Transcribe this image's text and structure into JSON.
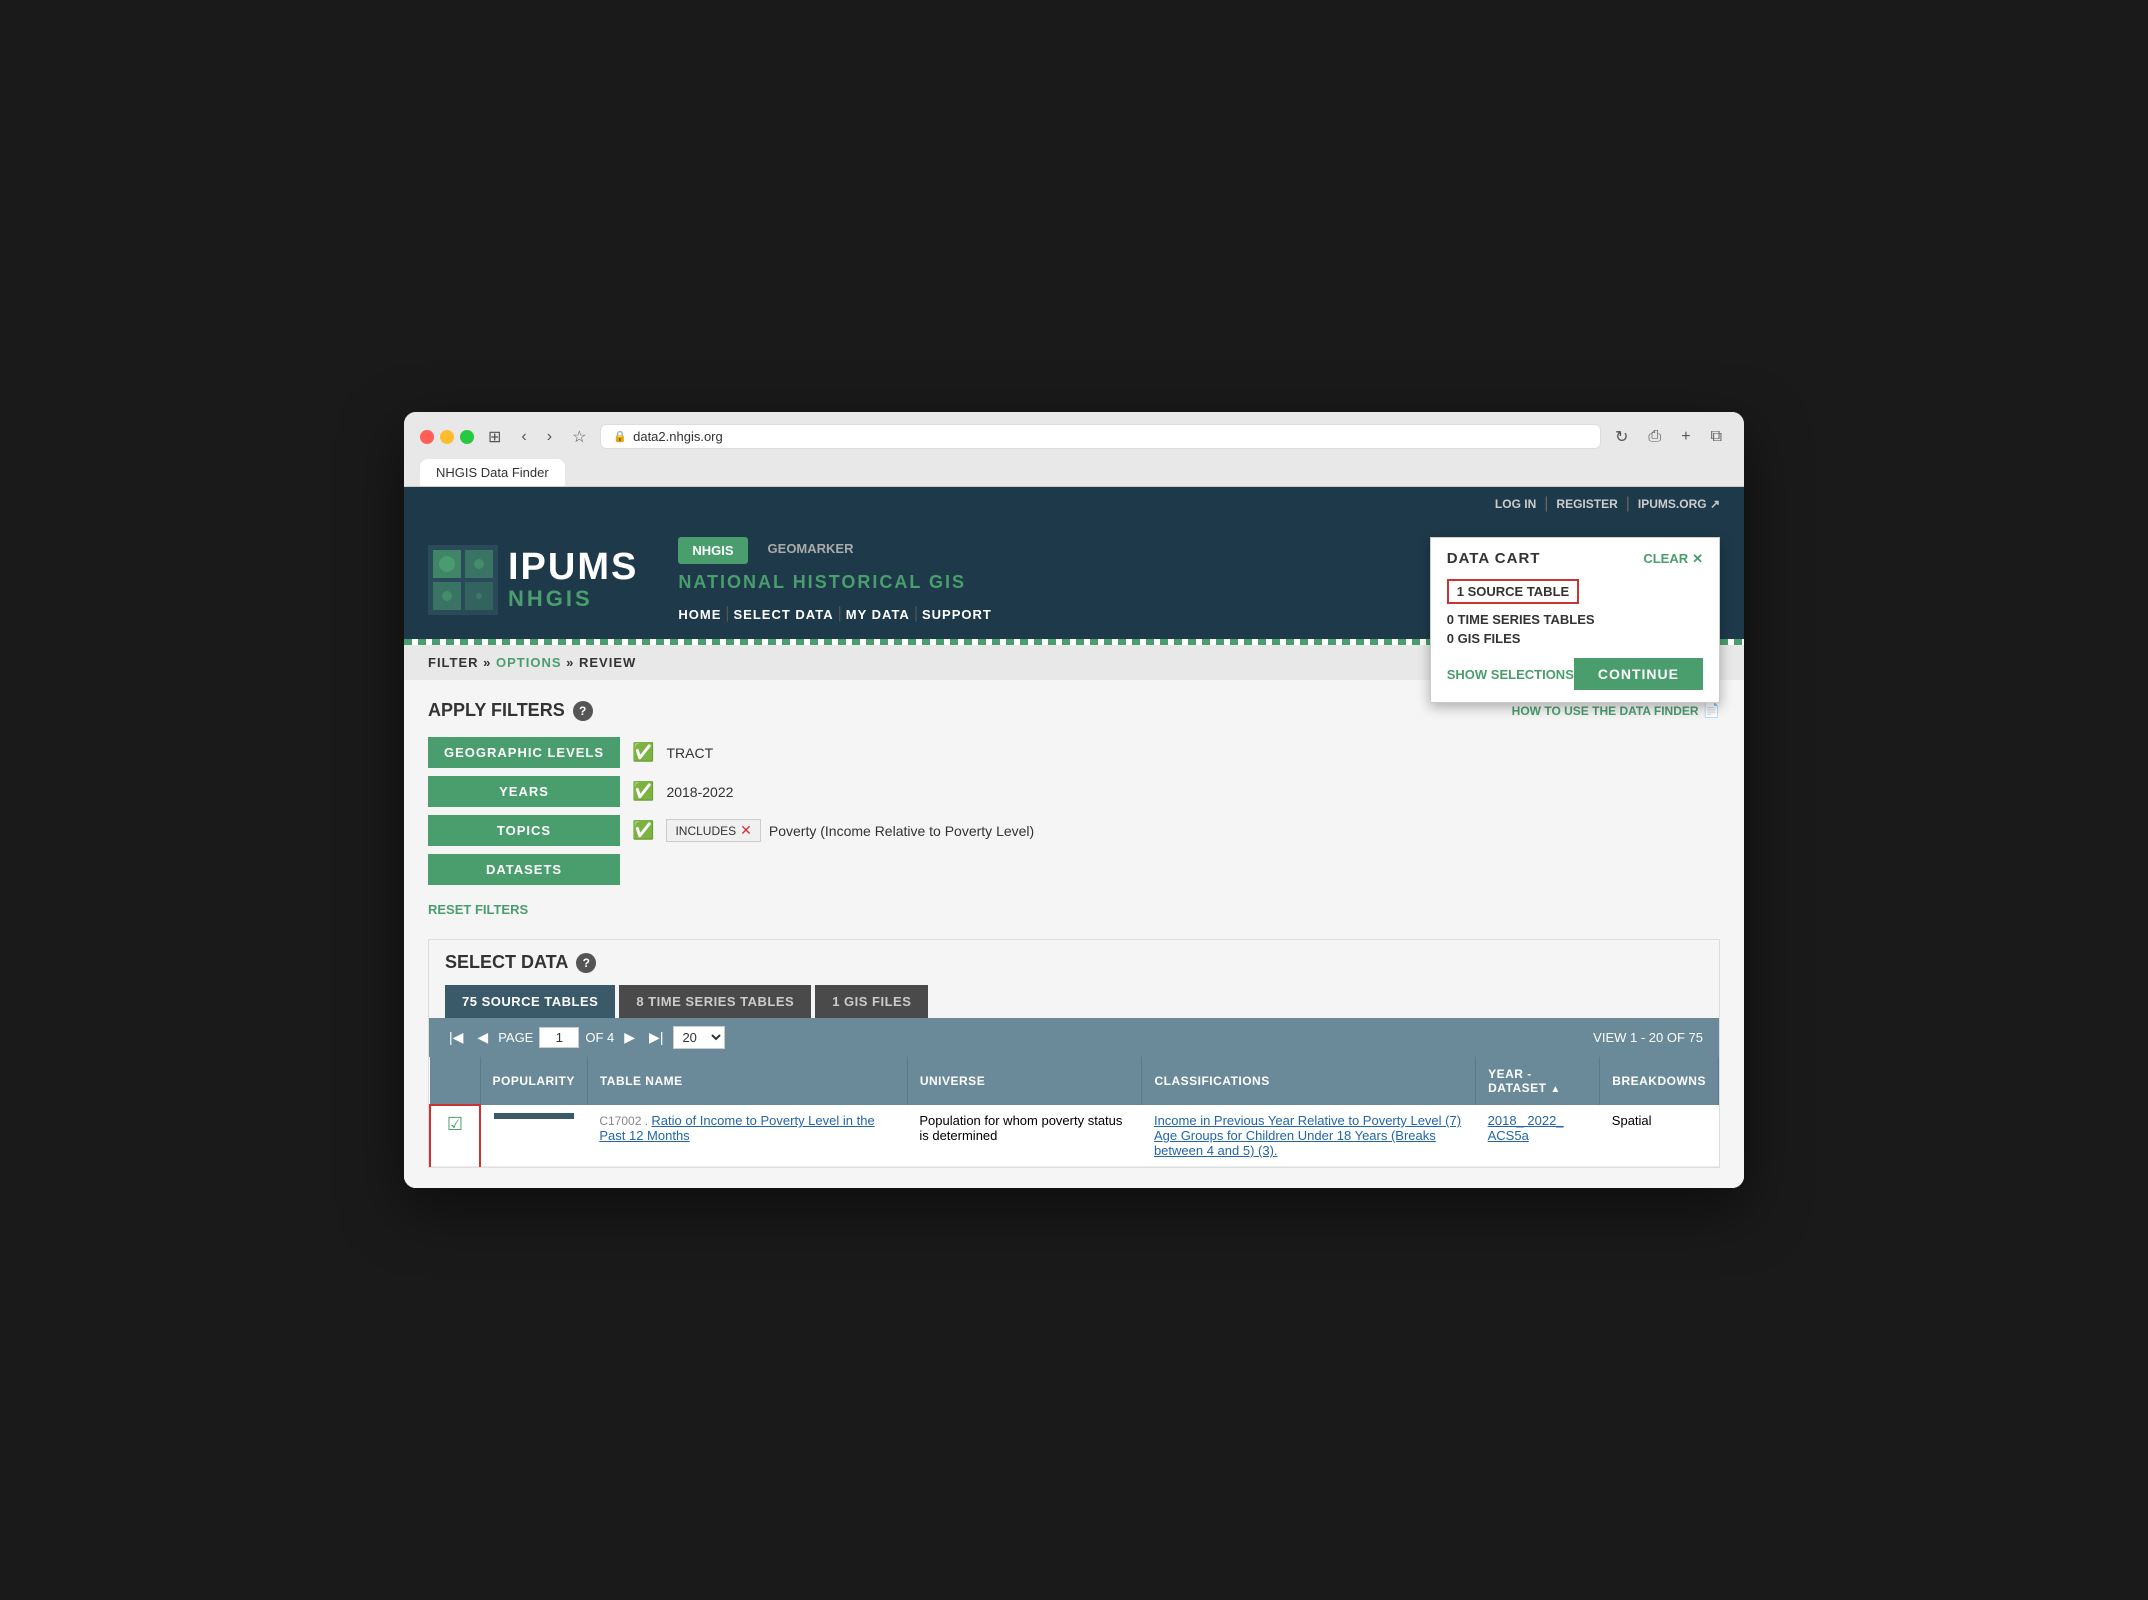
{
  "browser": {
    "url": "data2.nhgis.org",
    "tab_title": "NHGIS Data Finder"
  },
  "topnav": {
    "login": "LOG IN",
    "register": "REGISTER",
    "ipums": "IPUMS.ORG"
  },
  "header": {
    "logo_name": "IPUMS",
    "logo_sub": "NHGIS",
    "product_nhgis": "NHGIS",
    "product_geomarker": "GEOMARKER",
    "product_title": "NATIONAL HISTORICAL GIS",
    "nav_home": "HOME",
    "nav_select": "SELECT DATA",
    "nav_mydata": "MY DATA",
    "nav_support": "SUPPORT"
  },
  "cart": {
    "title": "DATA CART",
    "clear": "CLEAR",
    "source_tables": "1  SOURCE TABLE",
    "time_series": "0 TIME SERIES TABLES",
    "gis_files": "0 GIS FILES",
    "show_selections": "SHOW SELECTIONS",
    "continue": "CONTINUE"
  },
  "breadcrumb": {
    "filter": "FILTER",
    "options": "OPTIONS",
    "review": "REVIEW"
  },
  "filters": {
    "title": "APPLY FILTERS",
    "how_to": "HOW TO USE THE DATA FINDER",
    "geo_levels": "GEOGRAPHIC LEVELS",
    "geo_value": "TRACT",
    "years": "YEARS",
    "years_value": "2018-2022",
    "topics": "TOPICS",
    "includes": "INCLUDES",
    "topic_value": "Poverty (Income Relative to Poverty Level)",
    "datasets": "DATASETS",
    "reset": "RESET FILTERS"
  },
  "select_data": {
    "title": "SELECT DATA",
    "tab_source": "75 SOURCE TABLES",
    "tab_timeseries": "8 TIME SERIES TABLES",
    "tab_gis": "1 GIS FILES"
  },
  "pagination": {
    "page_label": "PAGE",
    "current_page": "1",
    "total_pages": "OF 4",
    "per_page": "20",
    "view_text": "VIEW 1 - 20 OF 75"
  },
  "table_headers": {
    "select": "",
    "popularity": "POPULARITY",
    "table_name": "TABLE NAME",
    "universe": "UNIVERSE",
    "classifications": "CLASSIFICATIONS",
    "year_dataset": "YEAR - DATASET",
    "breakdowns": "BREAKDOWNS"
  },
  "table_rows": [
    {
      "checked": true,
      "popularity_width": 70,
      "code": "C17002 .",
      "name": "Ratio of Income to Poverty Level in the Past 12 Months",
      "universe": "Population for whom poverty status is determined",
      "classifications": [
        "Income in Previous Year Relative to Poverty Level (7)",
        "Age Groups for Children Under 18 Years (Breaks between 4 and 5) (3)."
      ],
      "year_dataset": "2018_ 2022_ ACS5a",
      "breakdowns": "Spatial"
    }
  ]
}
